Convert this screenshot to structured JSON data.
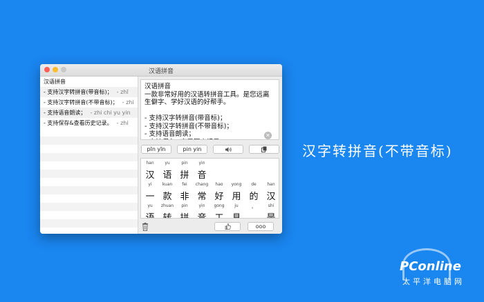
{
  "window": {
    "title": "汉语拼音"
  },
  "history": [
    {
      "title": "汉语拼音",
      "pinyin": ""
    },
    {
      "title": "- 支持汉字转拼音(带音标)；",
      "pinyin": "- zhī"
    },
    {
      "title": "- 支持汉字转拼音(不带音标)；",
      "pinyin": "- zhi"
    },
    {
      "title": "- 支持语音朗读；",
      "pinyin": "- zhi chi yu yin"
    },
    {
      "title": "- 支持保存&查看历史记录。",
      "pinyin": "- zhi"
    }
  ],
  "input": {
    "lines": [
      "汉语拼音",
      "一款非常好用的汉语转拼音工具。是您远离生僻字、学好汉语的好帮手。",
      "",
      "- 支持汉字转拼音(带音标)；",
      "- 支持汉字转拼音(不带音标)；",
      "- 支持语音朗读；",
      "- 支持保存&查看历史记录。"
    ]
  },
  "buttons": {
    "pinyin_tone": "pīn yīn",
    "pinyin_plain": "pin yin",
    "speak_icon": "speaker-icon",
    "copy_icon": "copy-icon",
    "like_icon": "thumb-icon",
    "more_label": "ooo"
  },
  "output": {
    "rows": [
      {
        "py": [
          "han",
          "yu",
          "pin",
          "yin"
        ],
        "hz": [
          "汉",
          "语",
          "拼",
          "音"
        ]
      },
      {
        "py": [
          "yi",
          "kuan",
          "fei",
          "chang",
          "hao",
          "yong",
          "de",
          "han"
        ],
        "hz": [
          "一",
          "款",
          "非",
          "常",
          "好",
          "用",
          "的",
          "汉"
        ]
      },
      {
        "py": [
          "yu",
          "zhuan",
          "pin",
          "yin",
          "gong",
          "ju",
          "。",
          "shi"
        ],
        "hz": [
          "语",
          "转",
          "拼",
          "音",
          "工",
          "具",
          "。",
          "是"
        ]
      }
    ]
  },
  "caption": "汉字转拼音(不带音标)",
  "watermark": {
    "brand": "PConline",
    "sub": "太平洋电脑网"
  }
}
